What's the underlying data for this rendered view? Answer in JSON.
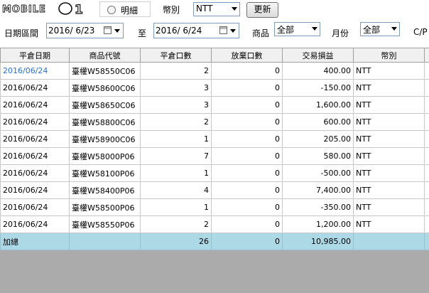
{
  "logo": {
    "text": "MOBILE01"
  },
  "filters": {
    "radio_detail_label": "明細",
    "currency_label": "幣別",
    "currency_value": "NTT",
    "refresh_label": "更新",
    "date_range_label": "日期區間",
    "date_from": "2016/ 6/23",
    "to_label": "至",
    "date_to": "2016/ 6/24",
    "product_label": "商品",
    "product_value": "全部",
    "month_label": "月份",
    "month_value": "全部",
    "cp_label": "C/P"
  },
  "table": {
    "headers": [
      "平倉日期",
      "商品代號",
      "平倉口數",
      "放棄口數",
      "交易損益",
      "幣別"
    ],
    "rows": [
      [
        "2016/06/24",
        "臺權W58550C06",
        "2",
        "0",
        "400.00",
        "NTT"
      ],
      [
        "2016/06/24",
        "臺權W58600C06",
        "3",
        "0",
        "-150.00",
        "NTT"
      ],
      [
        "2016/06/24",
        "臺權W58650C06",
        "3",
        "0",
        "1,600.00",
        "NTT"
      ],
      [
        "2016/06/24",
        "臺權W58800C06",
        "2",
        "0",
        "600.00",
        "NTT"
      ],
      [
        "2016/06/24",
        "臺權W58900C06",
        "1",
        "0",
        "205.00",
        "NTT"
      ],
      [
        "2016/06/24",
        "臺權W58000P06",
        "7",
        "0",
        "580.00",
        "NTT"
      ],
      [
        "2016/06/24",
        "臺權W58100P06",
        "1",
        "0",
        "-500.00",
        "NTT"
      ],
      [
        "2016/06/24",
        "臺權W58400P06",
        "4",
        "0",
        "7,400.00",
        "NTT"
      ],
      [
        "2016/06/24",
        "臺權W58500P06",
        "1",
        "0",
        "-350.00",
        "NTT"
      ],
      [
        "2016/06/24",
        "臺權W58550P06",
        "2",
        "0",
        "1,200.00",
        "NTT"
      ]
    ],
    "total": [
      "加總",
      "",
      "26",
      "0",
      "10,985.00",
      ""
    ]
  }
}
